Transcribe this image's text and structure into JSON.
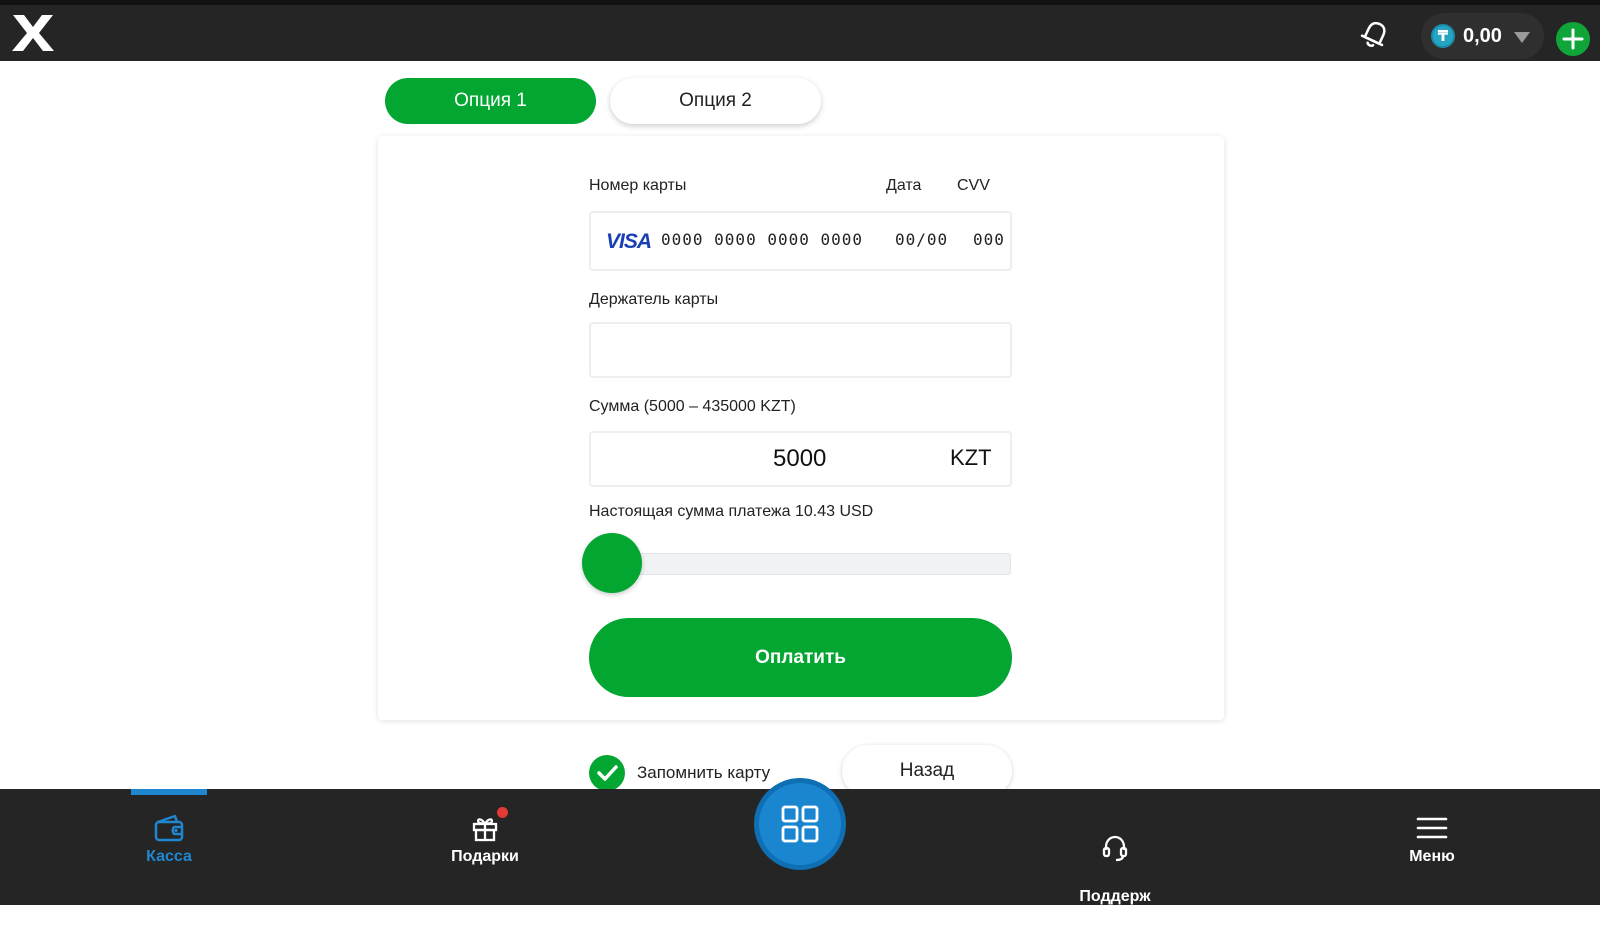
{
  "topbar": {
    "logo_icon": "x-logo-icon",
    "bell_icon": "bell-icon",
    "balance": {
      "currency_icon": "tenge-icon",
      "currency_symbol": "₸",
      "value": "0,00"
    },
    "add_icon": "plus-icon"
  },
  "tabs": [
    {
      "label": "Опция 1",
      "active": true
    },
    {
      "label": "Опция 2",
      "active": false
    }
  ],
  "form": {
    "card_number_label": "Номер карты",
    "date_label": "Дата",
    "cvv_label": "CVV",
    "card_brand": "VISA",
    "card_number_placeholder": "0000 0000 0000 0000",
    "date_placeholder": "00/00",
    "cvv_placeholder": "000",
    "holder_label": "Держатель карты",
    "holder_value": "",
    "amount_label": "Сумма (5000 – 435000 KZT)",
    "amount_value": "5000",
    "amount_currency": "KZT",
    "real_amount_label": "Настоящая сумма платежа 10.43 USD",
    "slider_level": 0,
    "pay_label": "Оплатить"
  },
  "footer_actions": {
    "remember_label": "Запомнить карту",
    "remember_checked": true,
    "back_label": "Назад"
  },
  "bottom_nav": {
    "items": [
      {
        "label": "Касса",
        "icon": "wallet-icon",
        "active": true
      },
      {
        "label": "Подарки",
        "icon": "gift-icon",
        "active": false,
        "badge": true
      },
      {
        "label": "Поддерж\nка",
        "icon": "headset-icon",
        "active": false
      },
      {
        "label": "Меню",
        "icon": "menu-icon",
        "active": false
      }
    ],
    "center_icon": "grid-icon"
  },
  "colors": {
    "accent_green": "#03a631",
    "nav_blue": "#1f86d0",
    "bar_dark": "#252525"
  }
}
